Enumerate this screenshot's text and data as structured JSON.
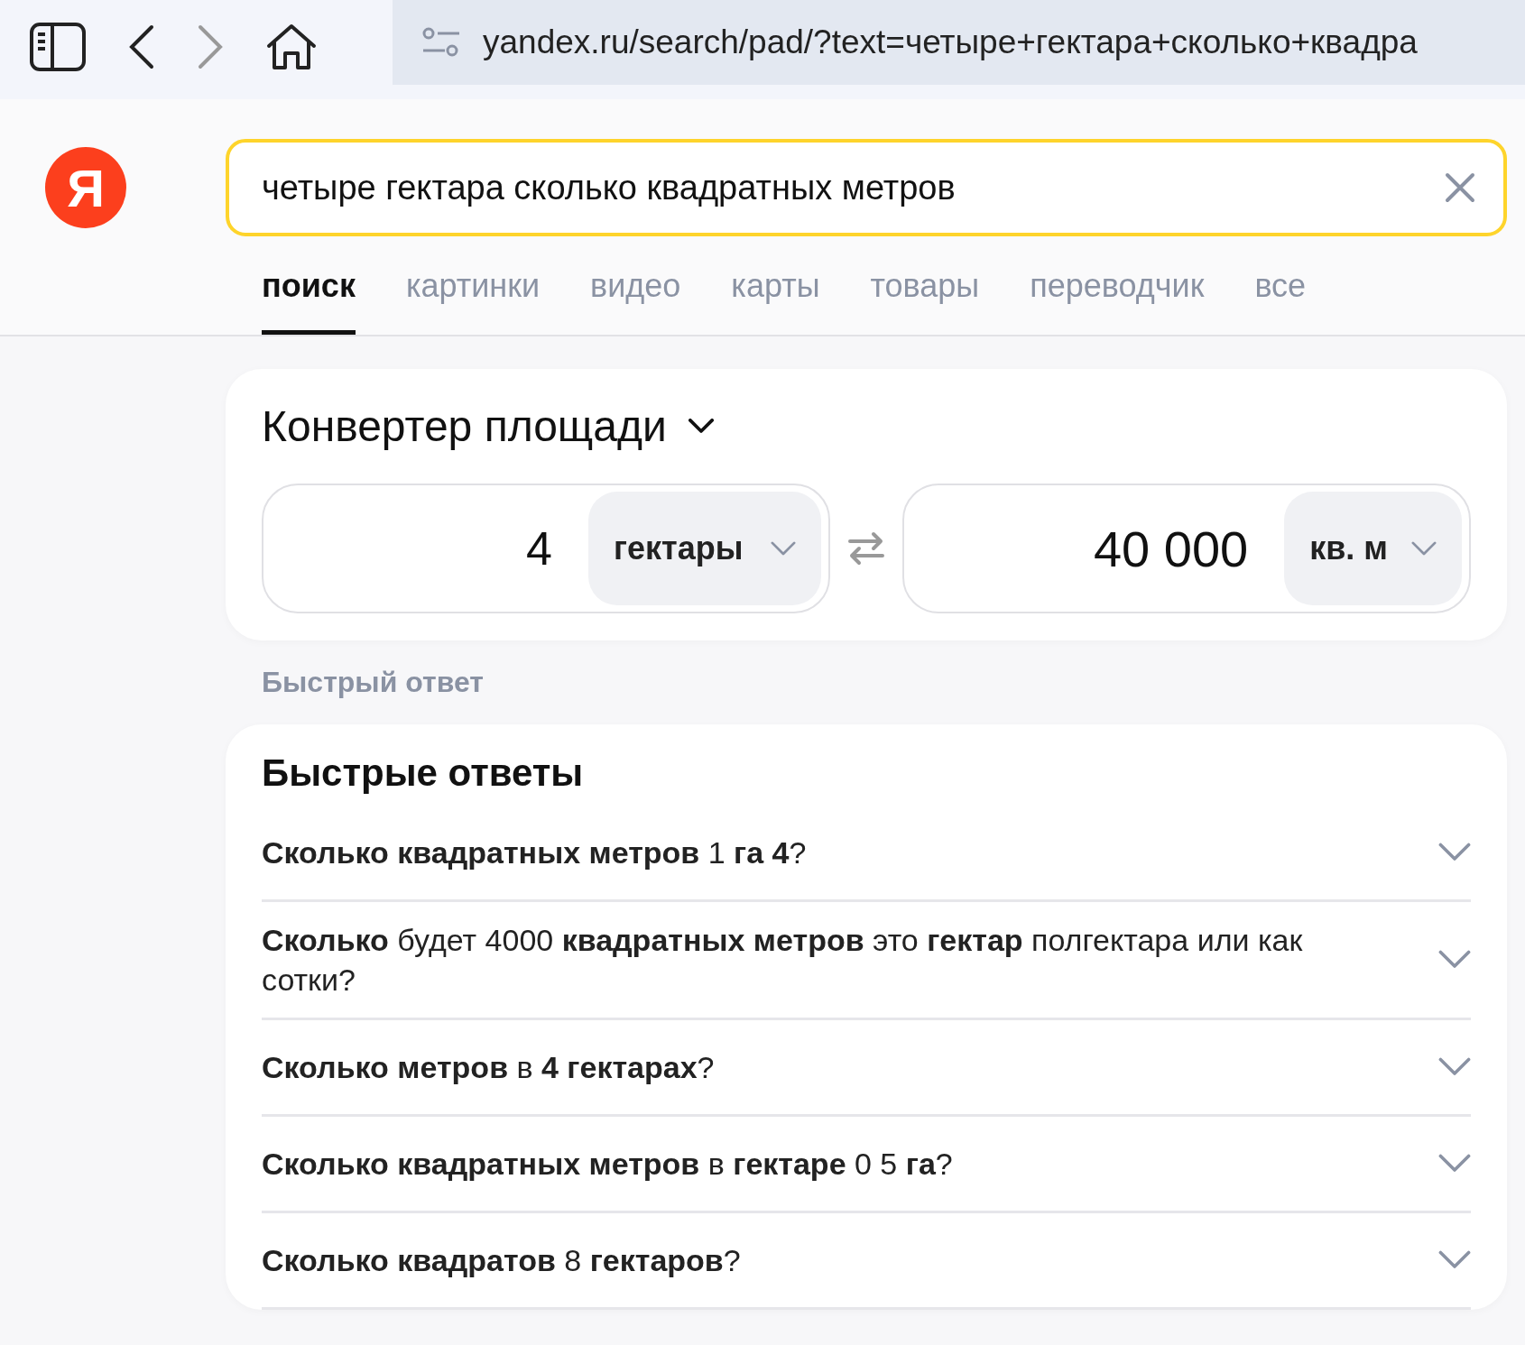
{
  "browser": {
    "address": "yandex.ru/search/pad/?text=четыре+гектара+сколько+квадра"
  },
  "logo": {
    "letter": "Я"
  },
  "search": {
    "value": "четыре гектара сколько квадратных метров"
  },
  "tabs": [
    {
      "label": "поиск",
      "selected": true
    },
    {
      "label": "картинки",
      "selected": false
    },
    {
      "label": "видео",
      "selected": false
    },
    {
      "label": "карты",
      "selected": false
    },
    {
      "label": "товары",
      "selected": false
    },
    {
      "label": "переводчик",
      "selected": false
    },
    {
      "label": "все",
      "selected": false
    }
  ],
  "converter": {
    "title": "Конвертер площади",
    "from": {
      "value": "4",
      "unit": "гектары"
    },
    "to": {
      "value": "40 000",
      "unit": "кв. м"
    }
  },
  "quick_answer_label": "Быстрый ответ",
  "faq": {
    "title": "Быстрые ответы",
    "items": [
      {
        "question": "**Сколько квадратных метров** 1 **га 4**?",
        "expanded": false
      },
      {
        "question": "**Сколько** будет 4000 **квадратных метров** это **гектар** полгектара или как сотки?",
        "expanded": false
      },
      {
        "question": "**Сколько метров** в **4 гектарах**?",
        "expanded": false
      },
      {
        "question": "**Сколько квадратных метров** в **гектаре** 0 5 **га**?",
        "expanded": false
      },
      {
        "question": "**Сколько квадратов** 8 **гектаров**?",
        "expanded": false
      }
    ]
  }
}
